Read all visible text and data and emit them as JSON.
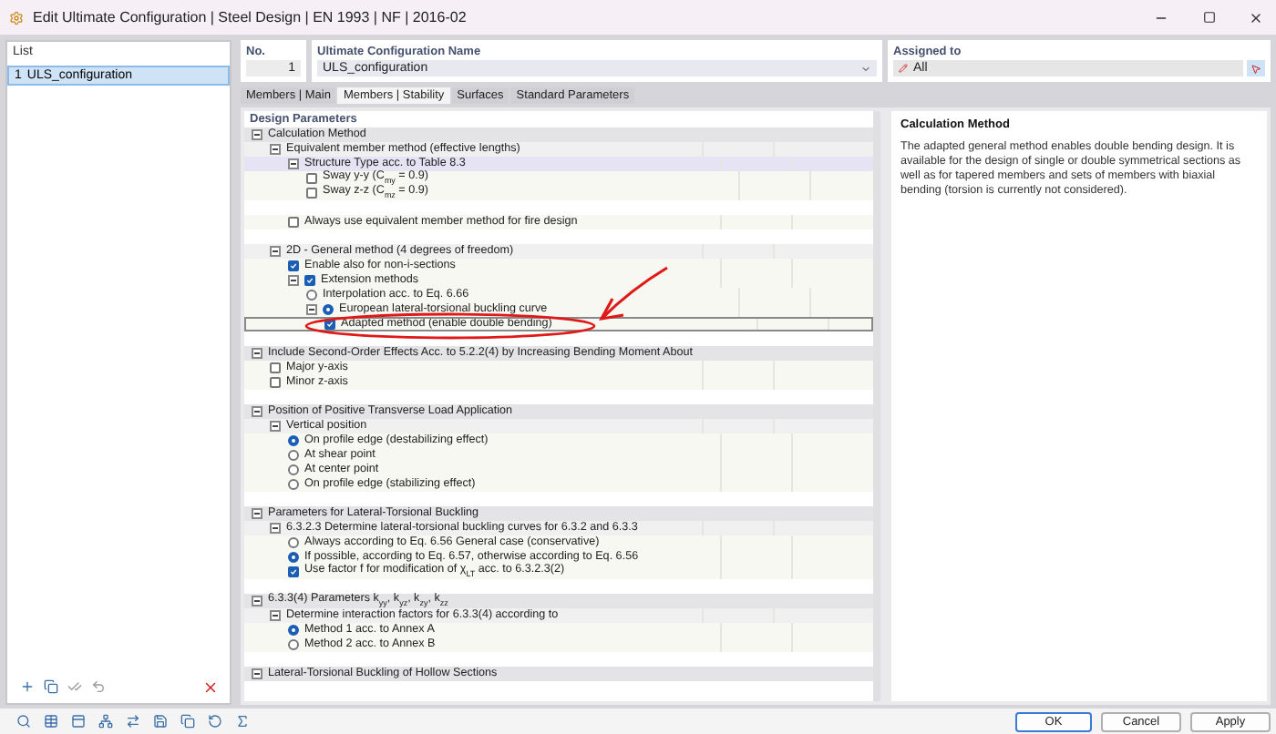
{
  "window": {
    "title": "Edit Ultimate Configuration | Steel Design | EN 1993 | NF | 2016-02"
  },
  "list": {
    "title": "List",
    "items": [
      {
        "number": "1",
        "name": "ULS_configuration",
        "selected": true
      }
    ]
  },
  "number_field": {
    "label": "No.",
    "value": "1"
  },
  "name_field": {
    "label": "Ultimate Configuration Name",
    "value": "ULS_configuration"
  },
  "assigned_field": {
    "label": "Assigned to",
    "value": "All"
  },
  "tabs": [
    {
      "label": "Members | Main",
      "selected": false
    },
    {
      "label": "Members | Stability",
      "selected": true
    },
    {
      "label": "Surfaces",
      "selected": false
    },
    {
      "label": "Standard Parameters",
      "selected": false
    }
  ],
  "design_parameters": {
    "title": "Design Parameters",
    "tree": [
      {
        "kind": "group",
        "label": "Calculation Method",
        "expanded": true,
        "children": [
          {
            "kind": "group",
            "label": "Equivalent member method (effective lengths)",
            "expanded": true,
            "children": [
              {
                "kind": "group",
                "label": "Structure Type acc. to Table 8.3",
                "expanded": true,
                "highlighted": true,
                "children": [
                  {
                    "kind": "checkbox",
                    "label": "Sway y-y (C$_{my}$ = 0.9)",
                    "checked": false
                  },
                  {
                    "kind": "checkbox",
                    "label": "Sway z-z (C$_{mz}$ = 0.9)",
                    "checked": false
                  }
                ]
              },
              {
                "kind": "blank"
              },
              {
                "kind": "checkbox",
                "label": "Always use equivalent member method for fire design",
                "checked": false
              },
              {
                "kind": "blank"
              }
            ]
          },
          {
            "kind": "group",
            "label": "2D - General method (4 degrees of freedom)",
            "expanded": true,
            "children": [
              {
                "kind": "checkbox",
                "label": "Enable also for non-i-sections",
                "checked": true
              },
              {
                "kind": "checkbox",
                "label": "Extension methods",
                "checked": true,
                "expanded": true,
                "children": [
                  {
                    "kind": "radio",
                    "label": "Interpolation acc. to Eq. 6.66",
                    "selected": false
                  },
                  {
                    "kind": "radio",
                    "label": "European lateral-torsional buckling curve",
                    "selected": true,
                    "expanded": true,
                    "children": [
                      {
                        "kind": "checkbox",
                        "label": "Adapted method (enable double bending)",
                        "checked": true,
                        "focused": true
                      }
                    ]
                  }
                ]
              }
            ]
          },
          {
            "kind": "blank"
          }
        ]
      },
      {
        "kind": "group",
        "label": "Include Second-Order Effects Acc. to 5.2.2(4) by Increasing Bending Moment About",
        "expanded": true,
        "children": [
          {
            "kind": "checkbox",
            "label": "Major y-axis",
            "checked": false
          },
          {
            "kind": "checkbox",
            "label": "Minor z-axis",
            "checked": false
          },
          {
            "kind": "blank"
          }
        ]
      },
      {
        "kind": "group",
        "label": "Position of Positive Transverse Load Application",
        "expanded": true,
        "children": [
          {
            "kind": "group",
            "label": "Vertical position",
            "expanded": true,
            "children": [
              {
                "kind": "radio",
                "label": "On profile edge (destabilizing effect)",
                "selected": true
              },
              {
                "kind": "radio",
                "label": "At shear point",
                "selected": false
              },
              {
                "kind": "radio",
                "label": "At center point",
                "selected": false
              },
              {
                "kind": "radio",
                "label": "On profile edge (stabilizing effect)",
                "selected": false
              }
            ]
          },
          {
            "kind": "blank"
          }
        ]
      },
      {
        "kind": "group",
        "label": "Parameters for Lateral-Torsional Buckling",
        "expanded": true,
        "children": [
          {
            "kind": "group",
            "label": "6.3.2.3 Determine lateral-torsional buckling curves for 6.3.2 and 6.3.3",
            "expanded": true,
            "children": [
              {
                "kind": "radio",
                "label": "Always according to Eq. 6.56 General case (conservative)",
                "selected": false
              },
              {
                "kind": "radio",
                "label": "If possible, according to Eq. 6.57, otherwise according to Eq. 6.56",
                "selected": true
              },
              {
                "kind": "checkbox",
                "label": "Use factor f for modification of χ$_{LT}$ acc. to 6.3.2.3(2)",
                "checked": true
              }
            ]
          },
          {
            "kind": "blank"
          }
        ]
      },
      {
        "kind": "group",
        "label": "6.3.3(4) Parameters k$_{yy}$, k$_{yz}$, k$_{zy}$, k$_{zz}$",
        "expanded": true,
        "children": [
          {
            "kind": "group",
            "label": "Determine interaction factors for 6.3.3(4) according to",
            "expanded": true,
            "children": [
              {
                "kind": "radio",
                "label": "Method 1 acc. to Annex A",
                "selected": true
              },
              {
                "kind": "radio",
                "label": "Method 2 acc. to Annex B",
                "selected": false
              }
            ]
          },
          {
            "kind": "blank"
          }
        ]
      },
      {
        "kind": "group",
        "label": "Lateral-Torsional Buckling of Hollow Sections",
        "expanded": true
      }
    ]
  },
  "description": {
    "title": "Calculation Method",
    "text": "The adapted general method enables double bending design. It is available for the design of single or double symmetrical sections as well as for tapered members and sets of members with biaxial bending (torsion is currently not considered)."
  },
  "buttons": [
    {
      "label": "OK"
    },
    {
      "label": "Cancel"
    },
    {
      "label": "Apply"
    }
  ]
}
